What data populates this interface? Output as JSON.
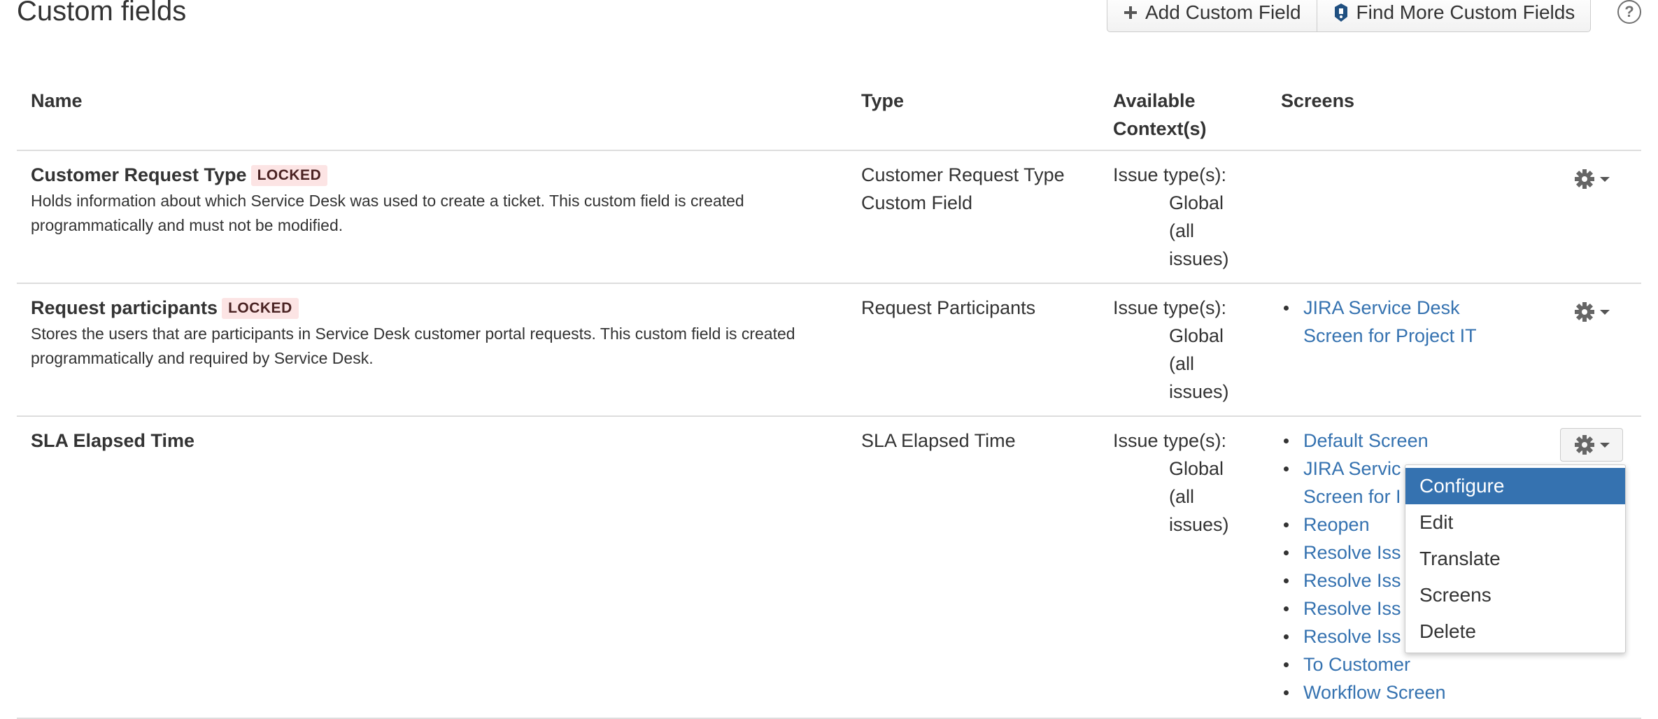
{
  "page": {
    "title": "Custom fields",
    "toolbar": {
      "add_label": "Add Custom Field",
      "find_label": "Find More Custom Fields"
    },
    "help_label": "?"
  },
  "table": {
    "headers": {
      "name": "Name",
      "type": "Type",
      "contexts_line1": "Available",
      "contexts_line2": "Context(s)",
      "screens": "Screens"
    },
    "rows": [
      {
        "name": "Customer Request Type",
        "badge": "LOCKED",
        "desc_line1": "Holds information about which Service Desk was used to create a ticket. This custom field is created",
        "desc_line2": "programmatically and must not be modified.",
        "type_line1": "Customer Request Type",
        "type_line2": "Custom Field",
        "ctx_label": "Issue type(s):",
        "ctx_lines": [
          "Global",
          "(all",
          "issues)"
        ],
        "screens": []
      },
      {
        "name": "Request participants",
        "badge": "LOCKED",
        "desc_line1": "Stores the users that are participants in Service Desk customer portal requests. This custom field is created",
        "desc_line2": "programmatically and required by Service Desk.",
        "type_line1": "Request Participants",
        "ctx_label": "Issue type(s):",
        "ctx_lines": [
          "Global",
          "(all",
          "issues)"
        ],
        "screens": [
          "JIRA Service Desk",
          "Screen for Project IT"
        ]
      },
      {
        "name": "SLA Elapsed Time",
        "type_line1": "SLA Elapsed Time",
        "ctx_label": "Issue type(s):",
        "ctx_lines": [
          "Global",
          "(all",
          "issues)"
        ],
        "screens": [
          "Default Screen",
          "JIRA Servic",
          "Screen for I",
          "Reopen",
          "Resolve Iss",
          "Resolve Iss",
          "Resolve Iss",
          "Resolve Iss",
          "To Customer",
          "Workflow Screen"
        ]
      }
    ]
  },
  "dropdown": {
    "items": [
      "Configure",
      "Edit",
      "Translate",
      "Screens",
      "Delete"
    ],
    "selected": "Configure"
  },
  "colors": {
    "link": "#3572b0",
    "selected_bg": "#3572b0",
    "badge_bg": "#fce4e4"
  },
  "icons": [
    "plus-icon",
    "jira-marketplace-icon",
    "help-icon",
    "gear-icon",
    "caret-down-icon"
  ]
}
